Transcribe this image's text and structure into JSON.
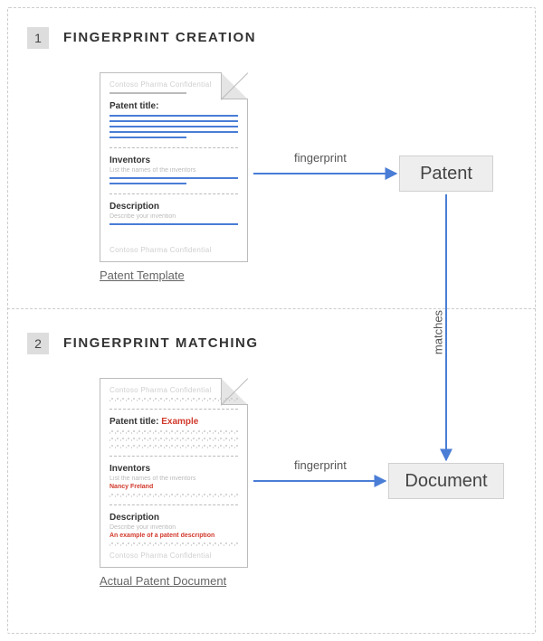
{
  "step1": {
    "num": "1",
    "title": "FINGERPRINT CREATION",
    "caption": "Patent Template",
    "doc": {
      "header": "Contoso Pharma Confidential",
      "title_label": "Patent title:",
      "inventors_label": "Inventors",
      "inventors_sub": "List the names of the inventors",
      "description_label": "Description",
      "description_sub": "Describe your invention",
      "footer": "Contoso Pharma Confidential"
    }
  },
  "step2": {
    "num": "2",
    "title": "FINGERPRINT MATCHING",
    "caption": "Actual Patent Document",
    "doc": {
      "header": "Contoso Pharma Confidential",
      "title_label": "Patent title:",
      "title_value": "Example",
      "inventors_label": "Inventors",
      "inventors_sub": "List the names of the inventors",
      "inventors_value": "Nancy Freland",
      "description_label": "Description",
      "description_sub": "Describe your invention",
      "description_value": "An example of a patent description",
      "footer": "Contoso Pharma Confidential"
    }
  },
  "arrows": {
    "fingerprint": "fingerprint",
    "matches": "matches"
  },
  "nodes": {
    "patent": "Patent",
    "document": "Document"
  }
}
